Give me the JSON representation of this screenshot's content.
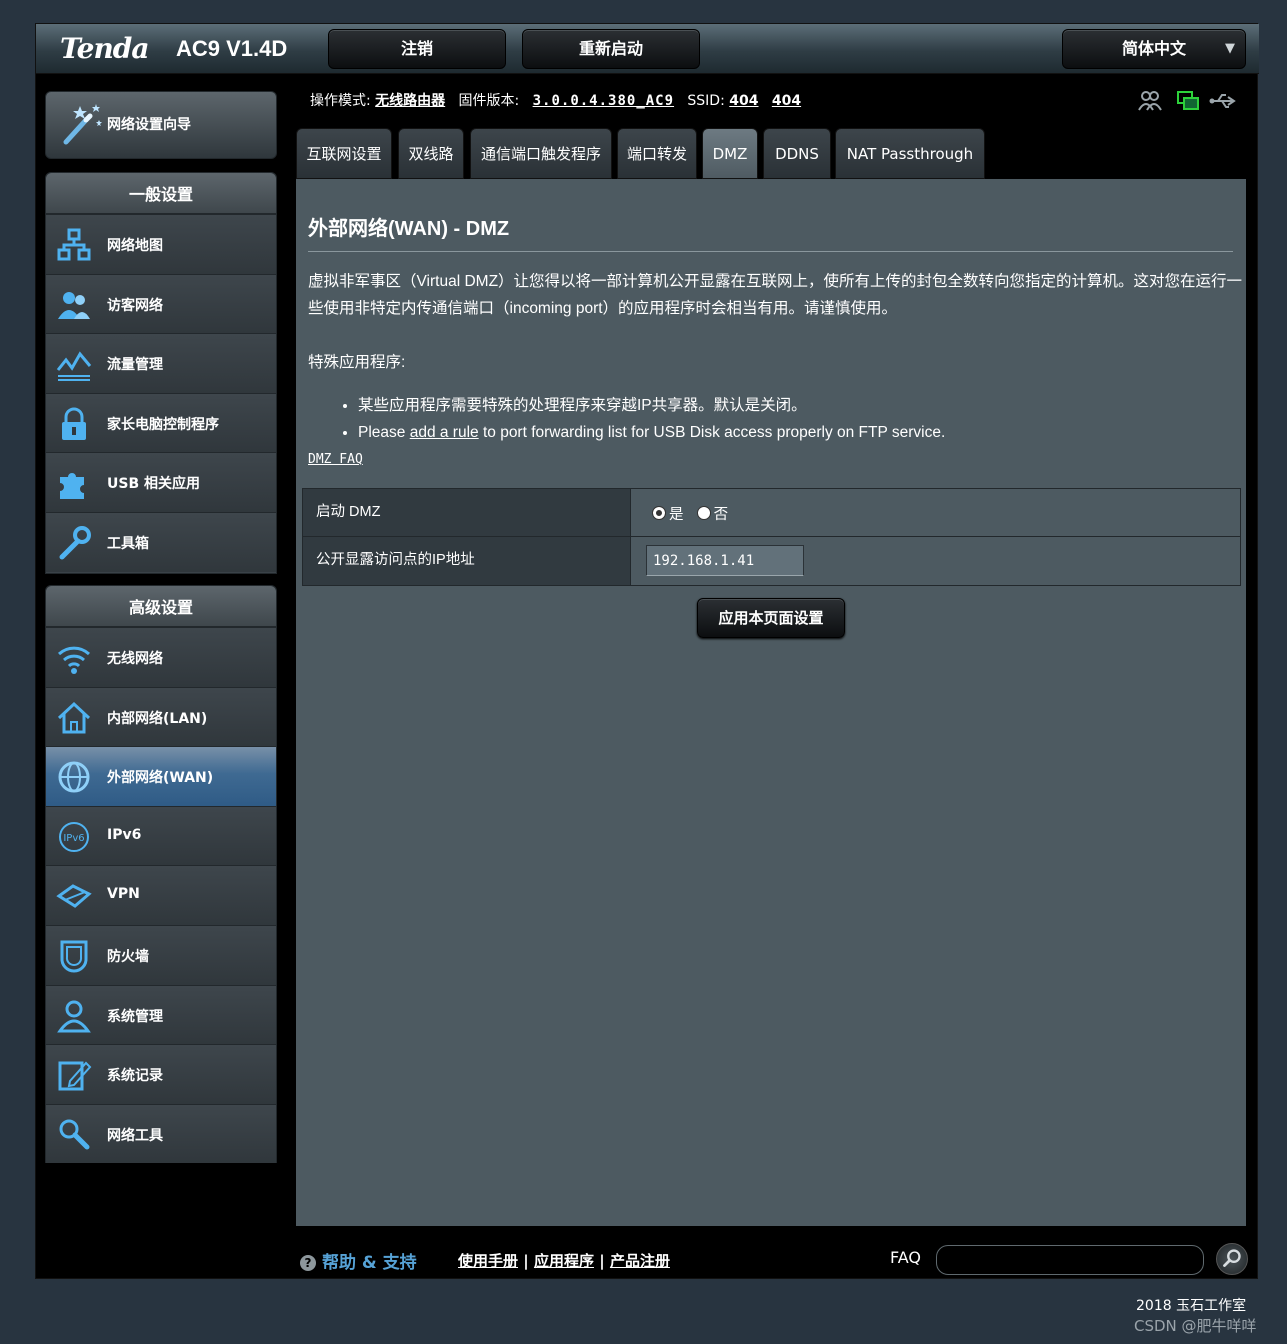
{
  "header": {
    "brand": "Tenda",
    "model": "AC9 V1.4D",
    "logout_label": "注销",
    "reboot_label": "重新启动",
    "language_label": "简体中文"
  },
  "status": {
    "mode_label": "操作模式:",
    "mode_value": "无线路由器",
    "firmware_label": "固件版本:",
    "firmware_value": "3.0.0.4.380_AC9",
    "ssid_label": "SSID:",
    "ssid_1": "404",
    "ssid_2": "404"
  },
  "sidebar": {
    "wizard_label": "网络设置向导",
    "general_title": "一般设置",
    "general_items": [
      {
        "label": "网络地图",
        "icon": "network-map-icon"
      },
      {
        "label": "访客网络",
        "icon": "guest-network-icon"
      },
      {
        "label": "流量管理",
        "icon": "traffic-icon"
      },
      {
        "label": "家长电脑控制程序",
        "icon": "parental-lock-icon"
      },
      {
        "label": "USB 相关应用",
        "icon": "usb-puzzle-icon"
      },
      {
        "label": "工具箱",
        "icon": "wrench-icon"
      }
    ],
    "advanced_title": "高级设置",
    "advanced_items": [
      {
        "label": "无线网络",
        "icon": "wifi-icon"
      },
      {
        "label": "内部网络(LAN)",
        "icon": "home-icon"
      },
      {
        "label": "外部网络(WAN)",
        "icon": "globe-icon"
      },
      {
        "label": "IPv6",
        "icon": "ipv6-icon"
      },
      {
        "label": "VPN",
        "icon": "vpn-icon"
      },
      {
        "label": "防火墙",
        "icon": "shield-icon"
      },
      {
        "label": "系统管理",
        "icon": "user-icon"
      },
      {
        "label": "系统记录",
        "icon": "log-edit-icon"
      },
      {
        "label": "网络工具",
        "icon": "network-tools-icon"
      }
    ]
  },
  "tabs": [
    "互联网设置",
    "双线路",
    "通信端口触发程序",
    "端口转发",
    "DMZ",
    "DDNS",
    "NAT Passthrough"
  ],
  "main": {
    "title": "外部网络(WAN) - DMZ",
    "description": "虚拟非军事区（Virtual DMZ）让您得以将一部计算机公开显露在互联网上，使所有上传的封包全数转向您指定的计算机。这对您在运行一些使用非特定内传通信端口（incoming port）的应用程序时会相当有用。请谨慎使用。",
    "special_title": "特殊应用程序:",
    "bullet_1": "某些应用程序需要特殊的处理程序来穿越IP共享器。默认是关闭。",
    "bullet_2_pre": "Please ",
    "bullet_2_link": "add a rule",
    "bullet_2_post": " to port forwarding list for USB Disk access properly on FTP service.",
    "faq_link": "DMZ FAQ",
    "enable_label": "启动 DMZ",
    "yes_label": "是",
    "no_label": "否",
    "ip_label": "公开显露访问点的IP地址",
    "ip_value": "192.168.1.41",
    "apply_label": "应用本页面设置"
  },
  "footer": {
    "help_label": "帮助 & 支持",
    "manual_link": "使用手册",
    "apps_link": "应用程序",
    "register_link": "产品注册",
    "sep": "|",
    "faq_label": "FAQ"
  },
  "copyright": "2018 玉石工作室",
  "watermark": "CSDN @肥牛咩咩"
}
